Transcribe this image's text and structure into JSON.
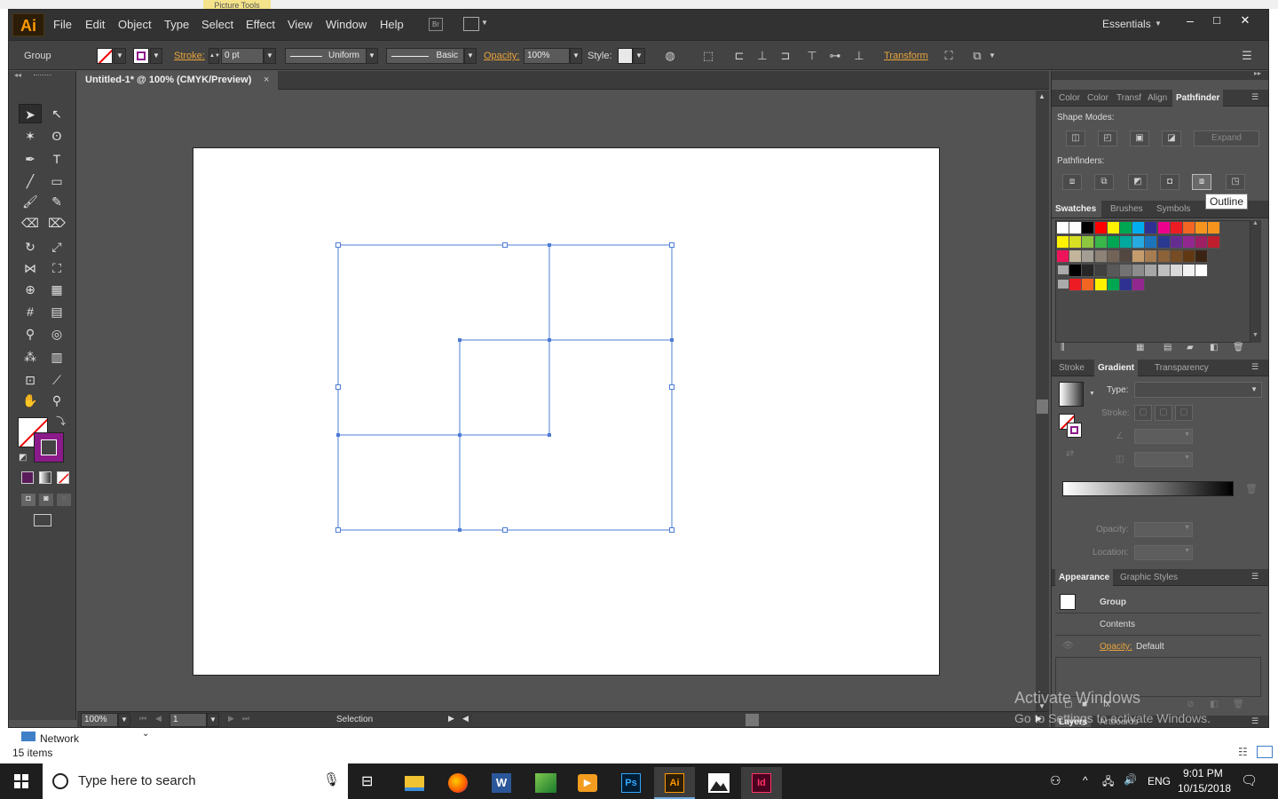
{
  "background": {
    "ribbon_tab": "Picture Tools",
    "nav_item": "Network",
    "item_count": "15 items"
  },
  "app": {
    "logo": "Ai",
    "menus": [
      "File",
      "Edit",
      "Object",
      "Type",
      "Select",
      "Effect",
      "View",
      "Window",
      "Help"
    ],
    "bridge_label": "Br",
    "workspace": "Essentials",
    "window_controls": {
      "minimize": "–",
      "maximize": "□",
      "close": "✕"
    }
  },
  "control_bar": {
    "selection_type": "Group",
    "stroke_label": "Stroke:",
    "stroke_value": "0 pt",
    "profile": "Uniform",
    "brush": "Basic",
    "opacity_label": "Opacity:",
    "opacity_value": "100%",
    "style_label": "Style:",
    "transform_label": "Transform"
  },
  "document": {
    "tab_title": "Untitled-1* @ 100% (CMYK/Preview)",
    "tab_close": "×",
    "zoom": "100%",
    "artboard_number": "1",
    "status_tool": "Selection"
  },
  "panels": {
    "top_tabs": [
      "Color",
      "Color",
      "Transf",
      "Align",
      "Pathfinder"
    ],
    "active_top_tab": "Pathfinder",
    "shape_modes_label": "Shape Modes:",
    "expand_label": "Expand",
    "pathfinders_label": "Pathfinders:",
    "tooltip": "Outline",
    "swatch_tabs": [
      "Swatches",
      "Brushes",
      "Symbols"
    ],
    "stroke_tabs": [
      "Stroke",
      "Gradient",
      "Transparency"
    ],
    "gradient_type_label": "Type:",
    "gradient_stroke_label": "Stroke:",
    "gradient_opacity_label": "Opacity:",
    "gradient_location_label": "Location:",
    "appearance_tabs": [
      "Appearance",
      "Graphic Styles"
    ],
    "appearance_group": "Group",
    "appearance_contents": "Contents",
    "appearance_opacity_label": "Opacity:",
    "appearance_opacity_value": "Default",
    "bottom_tabs": [
      "Layers",
      "Artboards"
    ],
    "swatch_colors": [
      [
        "#ffffff",
        "#ffffff",
        "#000000",
        "#ff0000",
        "#fff200",
        "#00a651",
        "#00aeef",
        "#2e3192",
        "#ec008c",
        "#ed1c24",
        "#f26522",
        "#f7941d",
        "#f7941d"
      ],
      [
        "#fff200",
        "#d7df23",
        "#8dc63f",
        "#39b54a",
        "#00a651",
        "#00a99d",
        "#27aae1",
        "#1c75bc",
        "#2b388f",
        "#662d91",
        "#92278f",
        "#9e1f63",
        "#be1e2d"
      ],
      [
        "#ed145b",
        "#c2b59b",
        "#a39e93",
        "#8c8276",
        "#736357",
        "#534741",
        "#c69c6d",
        "#a67c52",
        "#8c6239",
        "#754c24",
        "#603913",
        "#3c2415"
      ],
      [
        "#000000",
        "#262626",
        "#404040",
        "#595959",
        "#737373",
        "#8c8c8c",
        "#a6a6a6",
        "#bfbfbf",
        "#d9d9d9",
        "#f2f2f2",
        "#ffffff"
      ],
      [
        "#ed1c24",
        "#f26522",
        "#fff200",
        "#00a651",
        "#2e3192",
        "#92278f"
      ]
    ]
  },
  "watermark": {
    "line1": "Activate Windows",
    "line2": "Go to Settings to activate Windows."
  },
  "taskbar": {
    "search_placeholder": "Type here to search",
    "language": "ENG",
    "time": "9:01 PM",
    "date": "10/15/2018"
  }
}
